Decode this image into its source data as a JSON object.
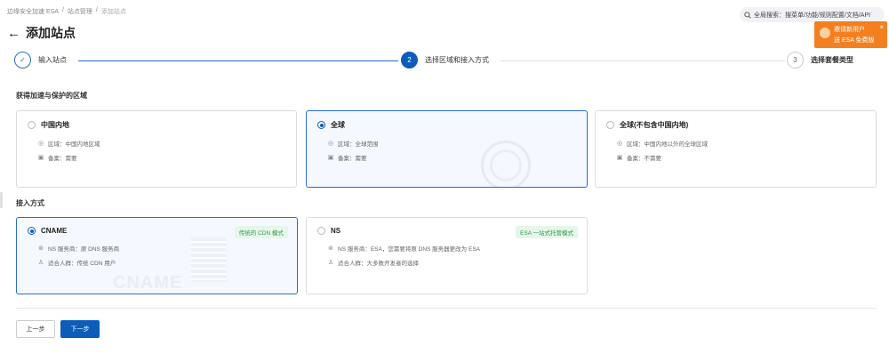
{
  "breadcrumb": {
    "items": [
      "边缘安全加速 ESA",
      "/",
      "站点管理",
      "/",
      "添加站点"
    ]
  },
  "search": {
    "label": "全局搜索：搜菜单/功能/规则配置/文档/API"
  },
  "page": {
    "title": "添加站点"
  },
  "promo": {
    "line1": "邀请新用户",
    "line2": "送 ESA 免费版"
  },
  "steps": [
    {
      "number": "✓",
      "label": "输入站点",
      "state": "done"
    },
    {
      "number": "2",
      "label": "选择区域和接入方式",
      "state": "active"
    },
    {
      "number": "3",
      "label": "选择套餐类型",
      "state": "todo"
    }
  ],
  "region_section": {
    "label": "获得加速与保护的区域",
    "cards": [
      {
        "title": "中国内地",
        "selected": false,
        "lines": [
          "区域：中国内地区域",
          "备案：需要"
        ]
      },
      {
        "title": "全球",
        "selected": true,
        "lines": [
          "区域：全球范围",
          "备案：需要"
        ]
      },
      {
        "title": "全球(不包含中国内地)",
        "selected": false,
        "lines": [
          "区域：中国内地以外的全球区域",
          "备案：不需要"
        ]
      }
    ]
  },
  "access_section": {
    "label": "接入方式",
    "cards": [
      {
        "title": "CNAME",
        "selected": true,
        "tag": "传统的 CDN 模式",
        "watermark": "CNAME",
        "lines": [
          "NS 服务商：原 DNS 服务商",
          "适合人群：传统 CDN 用户"
        ]
      },
      {
        "title": "NS",
        "selected": false,
        "tag": "ESA 一站式托管模式",
        "lines": [
          "NS 服务商：ESA，您需要将原 DNS 服务器更改为 ESA",
          "适合人群：大多数开发者的选择"
        ]
      }
    ]
  },
  "buttons": {
    "prev": "上一步",
    "next": "下一步"
  },
  "colors": {
    "primary": "#0b5db9",
    "promo": "#f47f1f",
    "tag_green": "#2f9a4c"
  }
}
